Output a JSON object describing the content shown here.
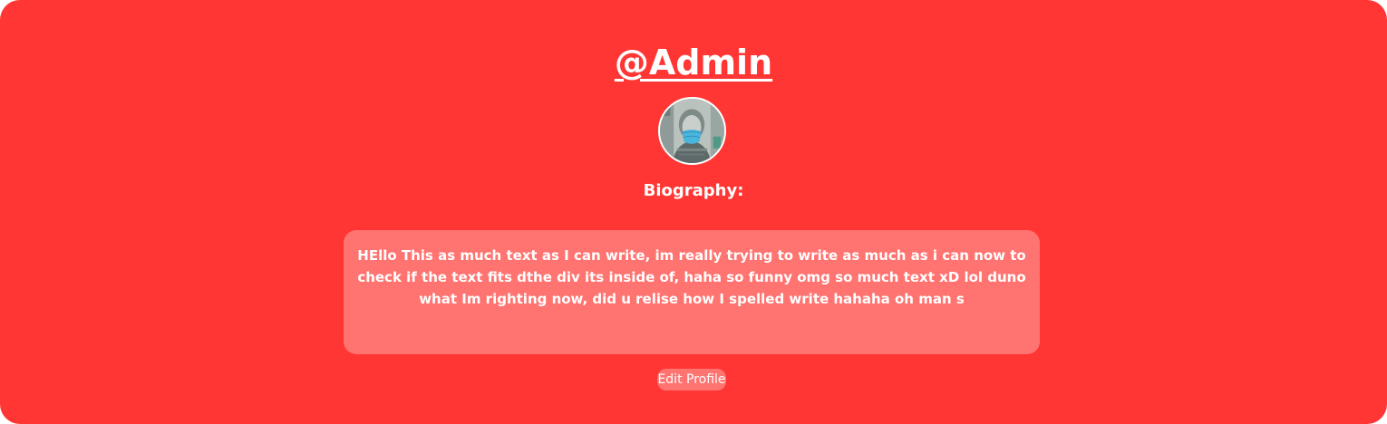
{
  "profile": {
    "username": "@Admin",
    "avatar_icon": "avatar-image",
    "bio_label": "Biography:",
    "bio_text": "HEllo This as much text as I can write, im really trying to write as much as i can now to check if the text fits dthe div its inside of, haha so funny omg so much text xD lol duno what Im righting now, did u relise how I spelled write hahaha oh man s",
    "edit_button_label": "Edit Profile"
  },
  "colors": {
    "card_background": "#ff3633",
    "bio_background": "#ff7370",
    "button_background": "#ff7370",
    "text": "#ffffff"
  }
}
